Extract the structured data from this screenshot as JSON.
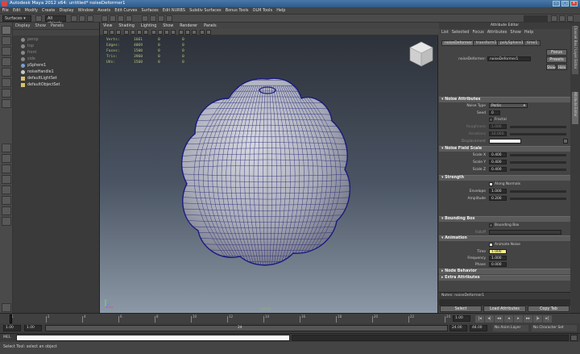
{
  "window": {
    "title": "Autodesk Maya 2012 x64: untitled*    noiseDeformer1"
  },
  "menubar": {
    "items": [
      "File",
      "Edit",
      "Modify",
      "Create",
      "Display",
      "Window",
      "Assets",
      "Edit Curves",
      "Surfaces",
      "Edit NURBS",
      "Subdiv Surfaces",
      "Bonus Tools",
      "OLM Tools",
      "Help"
    ]
  },
  "statusline": {
    "mode": "Surfaces",
    "selection_mask": "All objects"
  },
  "outliner": {
    "menu": [
      "Display",
      "Show",
      "Panels"
    ],
    "items": [
      {
        "label": "persp",
        "dim": true
      },
      {
        "label": "top",
        "dim": true
      },
      {
        "label": "front",
        "dim": true
      },
      {
        "label": "side",
        "dim": true
      },
      {
        "label": "pSphere1",
        "dim": false
      },
      {
        "label": "noiseHandle1",
        "dim": false
      },
      {
        "label": "defaultLightSet",
        "dim": false
      },
      {
        "label": "defaultObjectSet",
        "dim": false
      }
    ]
  },
  "viewport": {
    "menu": [
      "View",
      "Shading",
      "Lighting",
      "Show",
      "Renderer",
      "Panels"
    ],
    "hud": [
      {
        "label": "Verts:",
        "v1": "1661",
        "v2": "0",
        "v3": "0"
      },
      {
        "label": "Edges:",
        "v1": "4069",
        "v2": "0",
        "v3": "0"
      },
      {
        "label": "Faces:",
        "v1": "1500",
        "v2": "0",
        "v3": "0"
      },
      {
        "label": "Tris:",
        "v1": "3960",
        "v2": "0",
        "v3": "0"
      },
      {
        "label": "UVs:",
        "v1": "1560",
        "v2": "0",
        "v3": "0"
      }
    ],
    "camera_label": "persp"
  },
  "attribute_editor": {
    "tab_title": "Attribute Editor",
    "menu": [
      "List",
      "Selected",
      "Focus",
      "Attributes",
      "Show",
      "Help"
    ],
    "tabs": [
      "noiseDeformer1",
      "transform1",
      "polySphere1",
      "time1"
    ],
    "name_label": "noiseDeformer:",
    "name_value": "noiseDeformer1",
    "buttons": {
      "focus": "Focus",
      "presets": "Presets",
      "show": "Show",
      "hide": "Hide"
    },
    "sections": {
      "noise_attributes": "Noise Attributes",
      "noise_field_scale": "Noise Field Scale",
      "strength": "Strength",
      "bounding_box": "Bounding Box",
      "animation": "Animation",
      "node_behavior": "Node Behavior",
      "extra_attributes": "Extra Attributes"
    },
    "noise": {
      "type_label": "Noise Type",
      "type_value": "Perlin",
      "seed_label": "Seed",
      "seed_value": "0",
      "fractal_label": "Fractal",
      "roughness_label": "Roughness",
      "roughness_value": "1.000",
      "iterations_label": "Iterations",
      "iterations_value": "10.000",
      "displacement_label": "Displacement"
    },
    "scale": {
      "x_label": "Scale X",
      "x": "0.400",
      "y_label": "Scale Y",
      "y": "0.400",
      "z_label": "Scale Z",
      "z": "0.400"
    },
    "strength": {
      "along_normals": "Along Normals",
      "envelope_label": "Envelope",
      "envelope": "1.000",
      "amplitude_label": "Amplitude",
      "amplitude": "0.200"
    },
    "bbox": {
      "bounding_box_label": "Bounding Box",
      "falloff_label": "Falloff"
    },
    "animation": {
      "animate_noise": "Animate Noise",
      "time_label": "Time",
      "time": "1.000",
      "frequency_label": "Frequency",
      "frequency": "1.000",
      "phase_label": "Phase",
      "phase": "0.000"
    },
    "notes_label": "Notes: noiseDeformer1",
    "bottom_buttons": {
      "select": "Select",
      "load": "Load Attributes",
      "copy": "Copy Tab"
    }
  },
  "right_strip": {
    "channel_box": "Channel Box / Layer Editor",
    "attribute_editor": "Attribute Editor"
  },
  "timeline": {
    "ticks": [
      "1",
      "2",
      "4",
      "6",
      "8",
      "10",
      "12",
      "14",
      "16",
      "18",
      "20",
      "22",
      "24"
    ],
    "current_frame": "1.00"
  },
  "range": {
    "start": "1.00",
    "inner_start": "1.00",
    "inner_end": "24",
    "end": "24.00",
    "max": "48.00",
    "anim_layer": "No Anim Layer",
    "char_set": "No Character Set"
  },
  "command_line": {
    "label": "MEL"
  },
  "help_line": {
    "text": "Select Tool: select an object"
  }
}
